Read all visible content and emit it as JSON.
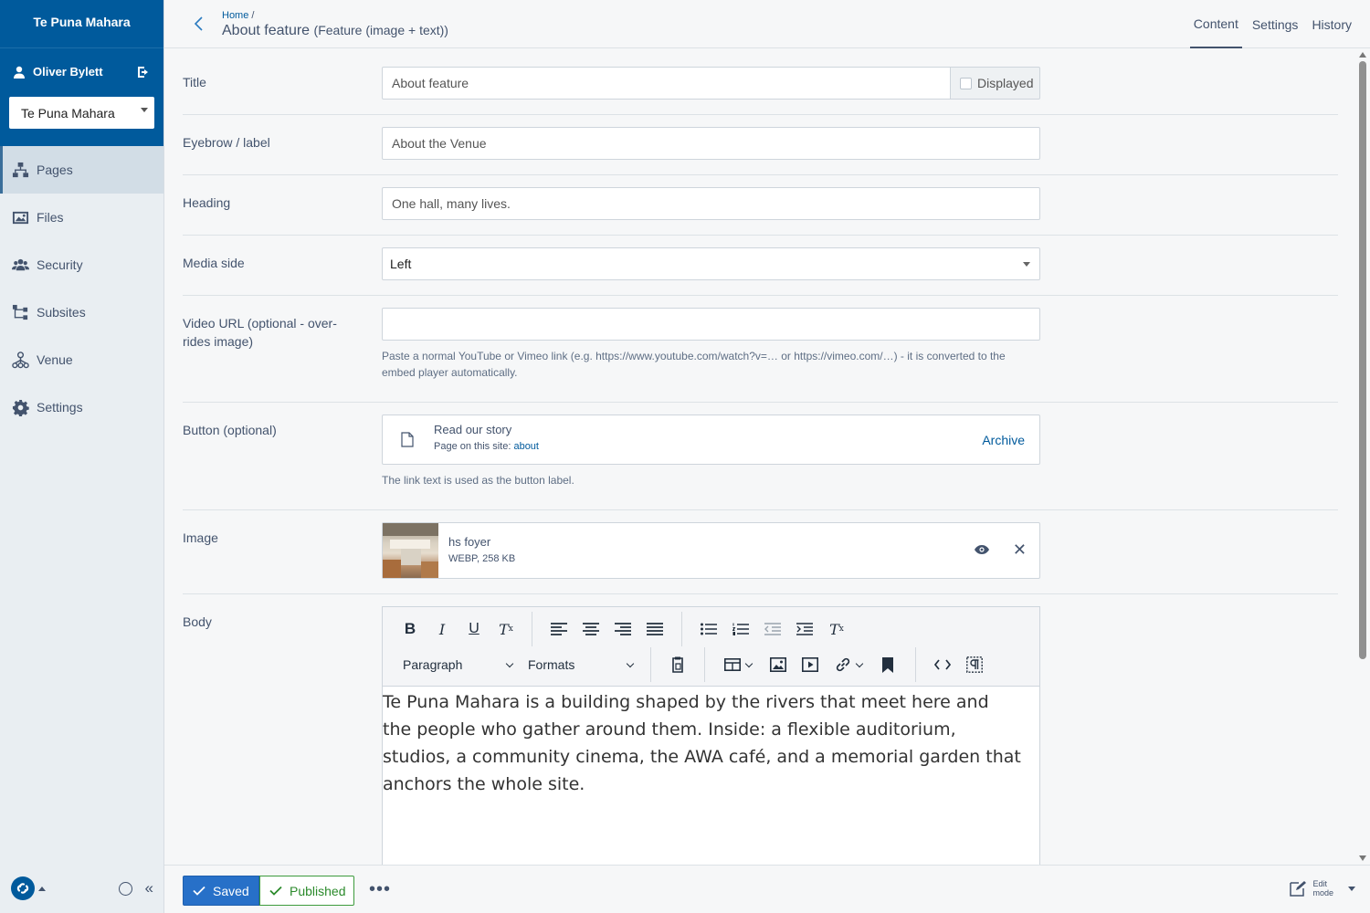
{
  "sidebar": {
    "brand": "Te Puna Mahara",
    "user": "Oliver Bylett",
    "subsite_select": "Te Puna Mahara",
    "items": [
      {
        "label": "Pages",
        "icon": "sitemap-icon"
      },
      {
        "label": "Files",
        "icon": "image-icon"
      },
      {
        "label": "Security",
        "icon": "users-icon"
      },
      {
        "label": "Subsites",
        "icon": "subsites-icon"
      },
      {
        "label": "Venue",
        "icon": "venue-icon"
      },
      {
        "label": "Settings",
        "icon": "gear-icon"
      }
    ],
    "collapse": "«"
  },
  "header": {
    "breadcrumb": "Home",
    "breadcrumb_sep": "/",
    "title": "About feature",
    "subtitle": "(Feature (image + text))",
    "tabs": [
      "Content",
      "Settings",
      "History"
    ]
  },
  "form": {
    "title": {
      "label": "Title",
      "value": "About feature",
      "addon": "Displayed"
    },
    "eyebrow": {
      "label": "Eyebrow / label",
      "value": "About the Venue"
    },
    "heading": {
      "label": "Heading",
      "value": "One hall, many lives."
    },
    "media_side": {
      "label": "Media side",
      "value": "Left"
    },
    "video": {
      "label_line1": "Video URL (optional - over-",
      "label_line2": "rides image)",
      "value": "",
      "help_line1": "Paste a normal YouTube or Vimeo link (e.g. https://www.youtube.com/watch?v=… or https://vimeo.com/…) - it is converted to the",
      "help_line2": "embed player automatically."
    },
    "button": {
      "label": "Button (optional)",
      "link_title": "Read our story",
      "link_prefix": "Page on this site:",
      "link_target": "about",
      "archive": "Archive",
      "help": "The link text is used as the button label."
    },
    "image": {
      "label": "Image",
      "name": "hs foyer",
      "meta": "WEBP, 258 KB"
    },
    "body": {
      "label": "Body",
      "block_format": "Paragraph",
      "formats": "Formats",
      "text": "Te Puna Mahara is a building shaped by the rivers that meet here and the people who gather around them. Inside: a flexible auditorium, studios, a community cinema, the AWA café, and a memorial garden that anchors the whole site."
    }
  },
  "footer": {
    "saved": "Saved",
    "published": "Published",
    "more": "•••",
    "edit_mode_line1": "Edit",
    "edit_mode_line2": "mode"
  },
  "colors": {
    "brand": "#005a9c",
    "saved": "#2770c8",
    "published": "#3d9b3d",
    "link": "#005a9c"
  }
}
